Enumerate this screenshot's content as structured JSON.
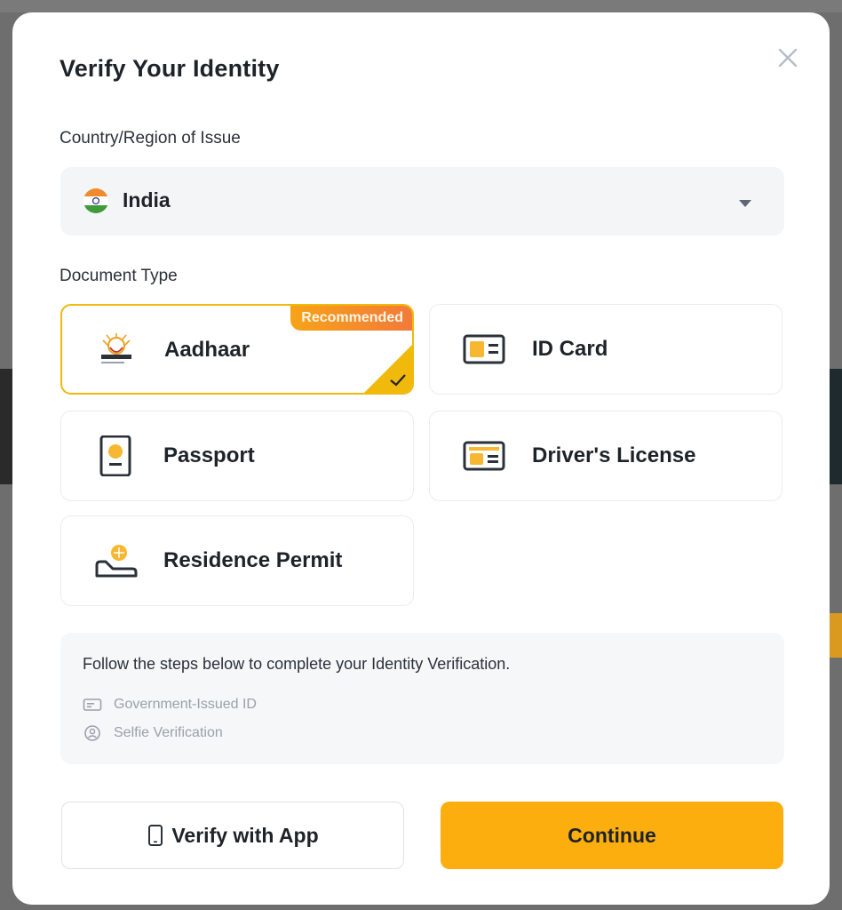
{
  "modal": {
    "title": "Verify Your Identity",
    "close_icon": "close-icon"
  },
  "country": {
    "label": "Country/Region of Issue",
    "selected": "India",
    "flag_icon": "india-flag-icon",
    "dropdown_icon": "caret-down-icon"
  },
  "document_type": {
    "label": "Document Type",
    "options": [
      {
        "label": "Aadhaar",
        "icon": "aadhaar-icon",
        "selected": true,
        "badge": "Recommended"
      },
      {
        "label": "ID Card",
        "icon": "id-card-icon",
        "selected": false
      },
      {
        "label": "Passport",
        "icon": "passport-icon",
        "selected": false
      },
      {
        "label": "Driver's License",
        "icon": "drivers-license-icon",
        "selected": false
      },
      {
        "label": "Residence Permit",
        "icon": "residence-permit-icon",
        "selected": false
      }
    ]
  },
  "steps": {
    "intro": "Follow the steps below to complete your Identity Verification.",
    "items": [
      {
        "label": "Government-Issued ID",
        "icon": "id-card-small-icon"
      },
      {
        "label": "Selfie Verification",
        "icon": "face-icon"
      }
    ]
  },
  "actions": {
    "verify_app_label": "Verify with App",
    "verify_app_icon": "phone-icon",
    "continue_label": "Continue"
  },
  "colors": {
    "accent": "#fcae0f",
    "selected_border": "#f0b90b",
    "badge_start": "#f7a318",
    "badge_end": "#f27a3a",
    "text_primary": "#1e2329",
    "text_muted": "#9aa1aa"
  }
}
